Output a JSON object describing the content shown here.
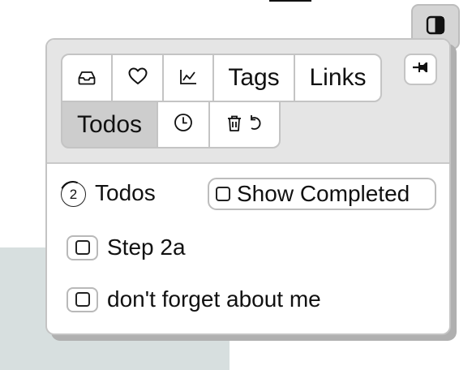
{
  "toolbar": {
    "sidebar_toggle_icon": "panel-toggle-icon"
  },
  "tabs": {
    "row1": [
      {
        "icon": "inbox-icon"
      },
      {
        "icon": "heart-icon"
      },
      {
        "icon": "chart-icon"
      },
      {
        "label": "Tags"
      },
      {
        "label": "Links"
      }
    ],
    "row2": [
      {
        "label": "Todos",
        "active": true
      },
      {
        "icon": "clock-icon"
      },
      {
        "icon": "trash-icon",
        "secondary_icon": "undo-icon"
      }
    ]
  },
  "pin": {
    "icon": "pin-icon"
  },
  "todos": {
    "count": "2",
    "title": "Todos",
    "show_completed_label": "Show Completed",
    "items": [
      {
        "text": "Step 2a",
        "checked": false
      },
      {
        "text": "don't forget about me",
        "checked": false
      }
    ]
  },
  "colors": {
    "header_bg": "#e5e5e5",
    "active_tab": "#cdcdcd",
    "background_block": "#d7dfdf"
  }
}
